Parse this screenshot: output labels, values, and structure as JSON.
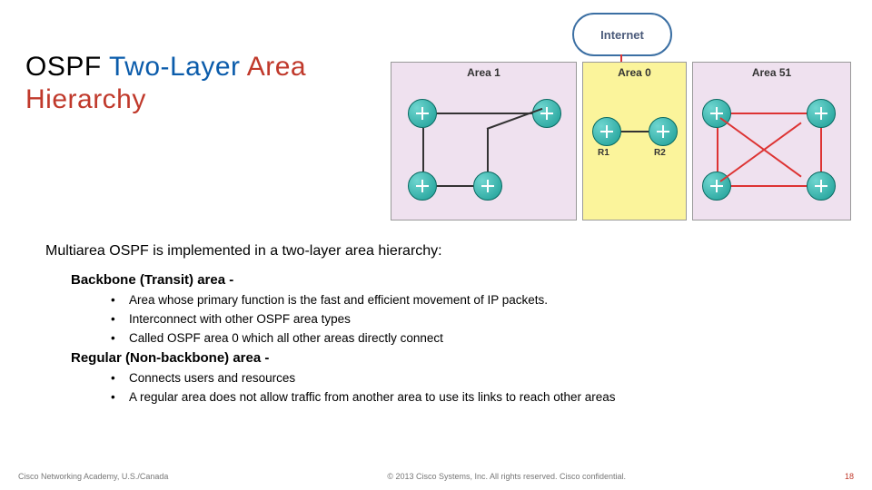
{
  "title": {
    "part_black1": "OSPF ",
    "part_blue": "Two-Layer",
    "part_black2": " ",
    "part_red": "Area Hierarchy"
  },
  "diagram": {
    "cloud_label": "Internet",
    "areas": [
      {
        "label": "Area 1"
      },
      {
        "label": "Area 0"
      },
      {
        "label": "Area 51"
      }
    ],
    "router_labels": {
      "r1": "R1",
      "r2": "R2"
    }
  },
  "content": {
    "intro": "Multiarea OSPF is implemented in a two-layer area hierarchy:",
    "backbone_heading": "Backbone (Transit) area -",
    "backbone_points": [
      "Area whose primary function is the fast and efficient movement of IP packets.",
      "Interconnect with other OSPF area types",
      "Called OSPF area 0 which all other areas directly connect"
    ],
    "regular_heading": "Regular (Non-backbone) area -",
    "regular_points": [
      "Connects users and resources",
      "A regular area does not allow traffic from another area to use its links to reach other areas"
    ]
  },
  "footer": {
    "left": "Cisco Networking Academy, U.S./Canada",
    "center": "© 2013 Cisco Systems, Inc. All rights reserved. Cisco confidential.",
    "page": "18"
  }
}
